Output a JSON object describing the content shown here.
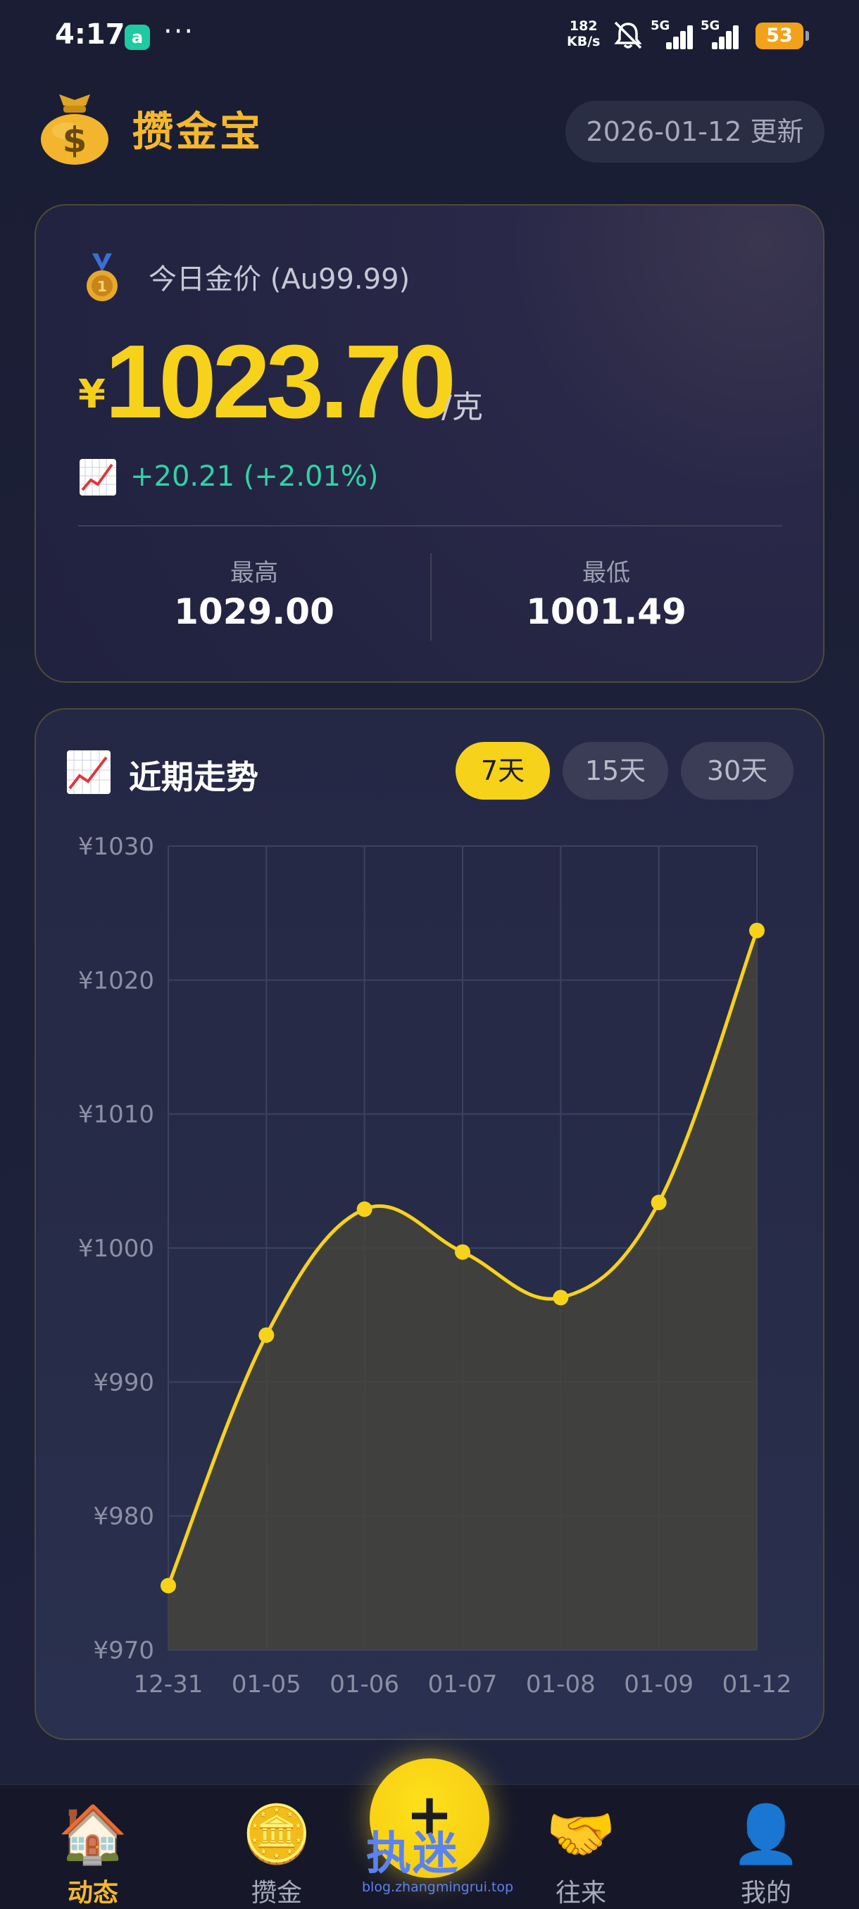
{
  "status_bar": {
    "time": "4:17",
    "app_icon_letter": "a",
    "more": "···",
    "speed_value": "182",
    "speed_unit": "KB/s",
    "sim1": "5G",
    "sim2": "5G",
    "battery": "53"
  },
  "header": {
    "title": "攒金宝",
    "update_text": "2026-01-12 更新",
    "logo_icon": "money-bag-icon"
  },
  "price_card": {
    "label": "今日金价 (Au99.99)",
    "currency": "¥",
    "price": "1023.70",
    "unit": "/克",
    "change": "+20.21  (+2.01%)",
    "high_label": "最高",
    "high_value": "1029.00",
    "low_label": "最低",
    "low_value": "1001.49",
    "colors": {
      "price": "#f7d21b",
      "change": "#2fd3a6"
    }
  },
  "trend_card": {
    "title": "近期走势",
    "ranges": [
      {
        "label": "7天",
        "active": true
      },
      {
        "label": "15天",
        "active": false
      },
      {
        "label": "30天",
        "active": false
      }
    ]
  },
  "chart_data": {
    "type": "area",
    "categories": [
      "12-31",
      "01-05",
      "01-06",
      "01-07",
      "01-08",
      "01-09",
      "01-12"
    ],
    "values": [
      974.8,
      993.5,
      1002.9,
      999.7,
      996.3,
      1003.4,
      1023.7
    ],
    "ytick_labels": [
      "¥1030",
      "¥1020",
      "¥1010",
      "¥1000",
      "¥990",
      "¥980",
      "¥970"
    ],
    "ylim": [
      970,
      1030
    ],
    "yticks": [
      1030,
      1020,
      1010,
      1000,
      990,
      980,
      970
    ],
    "grid": true,
    "line_color": "#f7d21b",
    "fill_color": "#44443c"
  },
  "bottom_nav": {
    "items": [
      {
        "label": "动态",
        "icon": "house-icon",
        "emoji": "🏠",
        "active": true
      },
      {
        "label": "攒金",
        "icon": "gold-coin-icon",
        "emoji": "🪙",
        "active": false
      },
      {
        "label": "往来",
        "icon": "handshake-icon",
        "emoji": "🤝",
        "active": false
      },
      {
        "label": "我的",
        "icon": "user-icon",
        "emoji": "👤",
        "active": false
      }
    ],
    "fab_symbol": "+"
  },
  "watermark": {
    "text": "执迷",
    "url": "blog.zhangmingrui.top"
  }
}
